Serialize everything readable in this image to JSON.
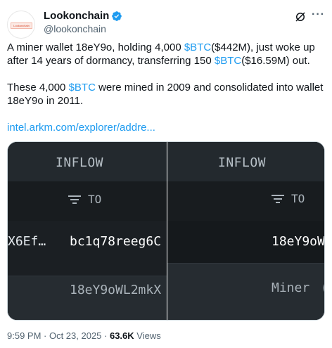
{
  "tweet": {
    "author_name": "Lookonchain",
    "handle": "@lookonchain",
    "avatar_text": "Lookonchain",
    "more_label": "···",
    "text_parts": {
      "p1_a": "A miner wallet 18eY9o, holding 4,000 ",
      "p1_cash1": "$BTC",
      "p1_b": "($442M), just woke up after 14 years of dormancy, transferring 150 ",
      "p1_cash2": "$BTC",
      "p1_c": "($16.59M) out.",
      "p2_a": "These 4,000 ",
      "p2_cash": "$BTC",
      "p2_b": " were mined in 2009 and consolidated into wallet 18eY9o in 2011.",
      "link": "intel.arkm.com/explorer/addre..."
    },
    "media": {
      "left": {
        "header": "INFLOW",
        "to_label": "TO",
        "row1_from": "X6Ef…",
        "row1_to": "bc1q78reeg6C",
        "row2_to": "18eY9oWL2mkX"
      },
      "right": {
        "header": "INFLOW",
        "to_label": "TO",
        "row1_to": "18eY9oW",
        "row2_to": "Miner",
        "row2_extra": "("
      }
    },
    "time": "9:59 PM · Oct 23, 2025 · ",
    "views_count": "63.6K",
    "views_label": " Views"
  },
  "colors": {
    "accent": "#1d9bf0",
    "verified": "#1d9bf0",
    "media_bg": "#1e2327"
  },
  "icons": [
    "verified-badge-icon",
    "grok-icon",
    "more-icon",
    "filter-icon"
  ]
}
